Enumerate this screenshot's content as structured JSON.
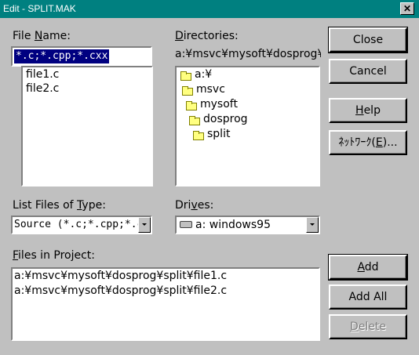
{
  "window": {
    "title": "Edit - SPLIT.MAK",
    "close_glyph": "✕"
  },
  "file_name": {
    "label_pre": "File ",
    "label_ul": "N",
    "label_post": "ame:",
    "value": "*.c;*.cpp;*.cxx",
    "files": [
      "file1.c",
      "file2.c"
    ]
  },
  "directories": {
    "label_ul": "D",
    "label_post": "irectories:",
    "path": "a:¥msvc¥mysoft¥dosprog¥s",
    "tree": [
      "a:¥",
      "msvc",
      "mysoft",
      "dosprog",
      "split"
    ]
  },
  "file_type": {
    "label_pre": "List Files of ",
    "label_ul": "T",
    "label_post": "ype:",
    "selected": "Source (*.c;*.cpp;*.c"
  },
  "drives": {
    "label_pre": "Dri",
    "label_ul": "v",
    "label_post": "es:",
    "selected": "a: windows95"
  },
  "project": {
    "label_ul": "F",
    "label_post": "iles in Project:",
    "files": [
      "a:¥msvc¥mysoft¥dosprog¥split¥file1.c",
      "a:¥msvc¥mysoft¥dosprog¥split¥file2.c"
    ]
  },
  "buttons": {
    "close": "Close",
    "cancel": "Cancel",
    "help_ul": "H",
    "help_post": "elp",
    "network_pre": "ﾈｯﾄﾜｰｸ(",
    "network_ul": "E",
    "network_post": ")...",
    "add_ul": "A",
    "add_post": "dd",
    "add_all": "Add All",
    "delete_ul": "D",
    "delete_post": "elete"
  }
}
